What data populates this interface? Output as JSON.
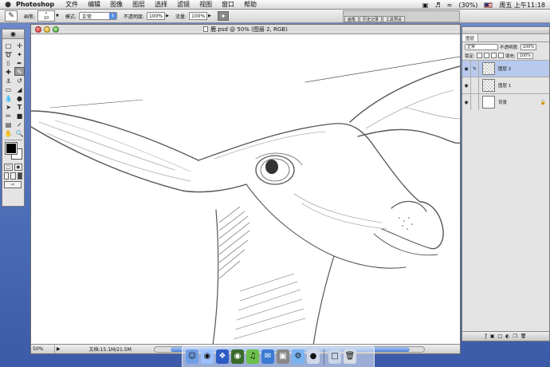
{
  "menubar": {
    "apple": "",
    "app_name": "Photoshop",
    "menus": [
      "文件",
      "编辑",
      "图像",
      "图层",
      "选择",
      "滤镜",
      "视图",
      "窗口",
      "帮助"
    ],
    "battery": "(30%)",
    "clock": "周五 上午11:18"
  },
  "options_bar": {
    "brush_label": "画笔:",
    "brush_size": "10",
    "mode_label": "模式:",
    "mode_value": "正常",
    "opacity_label": "不透明度:",
    "opacity_value": "100%",
    "flow_label": "流量:",
    "flow_value": "100%",
    "palette_tabs": [
      "画笔",
      "历史记录",
      "工具预设"
    ]
  },
  "document": {
    "title": "鹿.psd @ 50% (图层 2, RGB)",
    "zoom": "50%",
    "file_info": "文档:15.1M/21.5M"
  },
  "layers_panel": {
    "tabs": [
      "图层"
    ],
    "blend_mode": "正常",
    "opacity_label": "不透明度:",
    "opacity_value": "100%",
    "lock_label": "锁定:",
    "fill_label": "填充:",
    "fill_value": "100%",
    "layers": [
      {
        "name": "图层 2",
        "active": true,
        "thumb": "transparent"
      },
      {
        "name": "图层 1",
        "active": false,
        "thumb": "transparent"
      },
      {
        "name": "背景",
        "active": false,
        "thumb": "white",
        "locked": true
      }
    ]
  },
  "colors": {
    "accent": "#5a8fe0",
    "desktop": "#4d6fb8",
    "selection": "#b7c9ec"
  }
}
